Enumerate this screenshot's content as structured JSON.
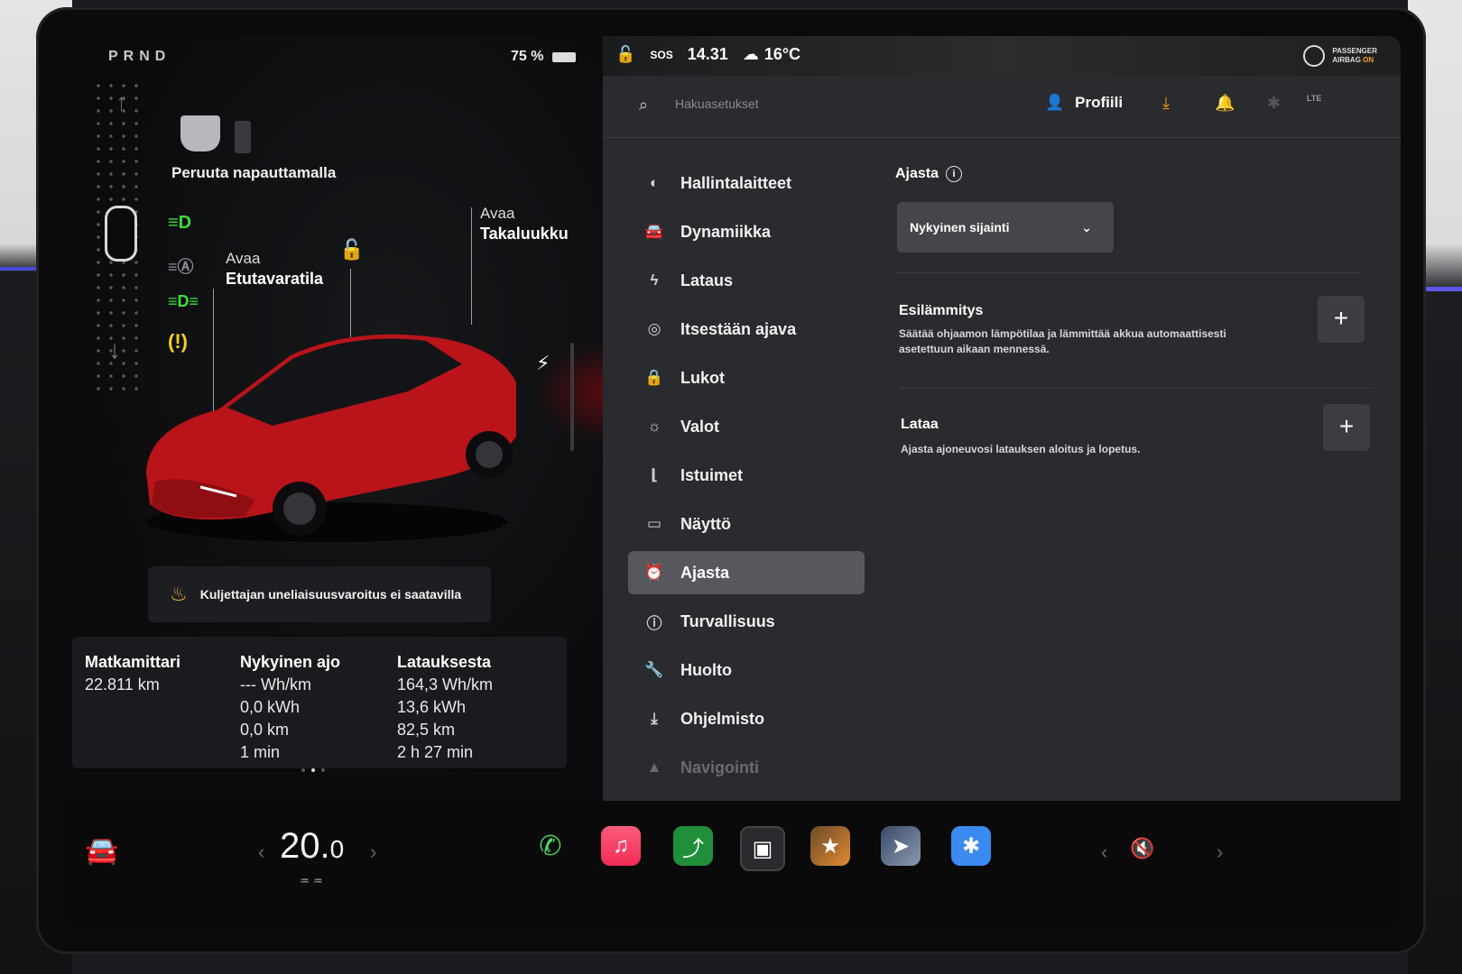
{
  "left": {
    "gear": "PRND",
    "battery": "75 %",
    "cancel_text": "Peruuta napauttamalla",
    "frunk": {
      "line1": "Avaa",
      "line2": "Etutavaratila"
    },
    "trunk": {
      "line1": "Avaa",
      "line2": "Takaluukku"
    },
    "drowsy_warning": "Kuljettajan uneliaisuusvaroitus ei saatavilla",
    "trip": {
      "odometer": {
        "title": "Matkamittari",
        "value": "22.811 km"
      },
      "current": {
        "title": "Nykyinen ajo",
        "lines": [
          "--- Wh/km",
          "0,0 kWh",
          "0,0 km",
          "1 min"
        ]
      },
      "since_charge": {
        "title": "Latauksesta",
        "lines": [
          "164,3 Wh/km",
          "13,6 kWh",
          "82,5 km",
          "2 h 27 min"
        ]
      }
    }
  },
  "status": {
    "sos": "SOS",
    "time": "14.31",
    "temp": "16°C",
    "airbag_line1": "PASSENGER",
    "airbag_line2": "AIRBAG",
    "airbag_on": "ON",
    "lte": "LTE"
  },
  "search": {
    "placeholder": "Hakuasetukset"
  },
  "profile": {
    "label": "Profiili"
  },
  "menu": [
    {
      "label": "Hallintalaitteet",
      "icon": "toggle-icon"
    },
    {
      "label": "Dynamiikka",
      "icon": "car-icon"
    },
    {
      "label": "Lataus",
      "icon": "bolt-icon"
    },
    {
      "label": "Itsestään ajava",
      "icon": "steering-wheel-icon"
    },
    {
      "label": "Lukot",
      "icon": "lock-icon"
    },
    {
      "label": "Valot",
      "icon": "sun-icon"
    },
    {
      "label": "Istuimet",
      "icon": "seat-icon"
    },
    {
      "label": "Näyttö",
      "icon": "display-icon"
    },
    {
      "label": "Ajasta",
      "icon": "alarm-icon"
    },
    {
      "label": "Turvallisuus",
      "icon": "alert-icon"
    },
    {
      "label": "Huolto",
      "icon": "wrench-icon"
    },
    {
      "label": "Ohjelmisto",
      "icon": "download-icon"
    },
    {
      "label": "Navigointi",
      "icon": "navigation-icon"
    }
  ],
  "schedule": {
    "title": "Ajasta",
    "location": "Nykyinen sijainti",
    "preheat": {
      "title": "Esilämmitys",
      "desc_line1": "Säätää ohjaamon lämpötilaa ja lämmittää akkua automaattisesti",
      "desc_line2": "asetettuun aikaan mennessä."
    },
    "charge": {
      "title": "Lataa",
      "desc": "Ajasta ajoneuvosi latauksen aloitus ja lopetus."
    }
  },
  "taskbar": {
    "temp_whole": "20.",
    "temp_decimal": "0"
  },
  "colors": {
    "accent_green": "#3ddc3d",
    "accent_amber": "#f4b23a",
    "car_red": "#c8161c"
  }
}
